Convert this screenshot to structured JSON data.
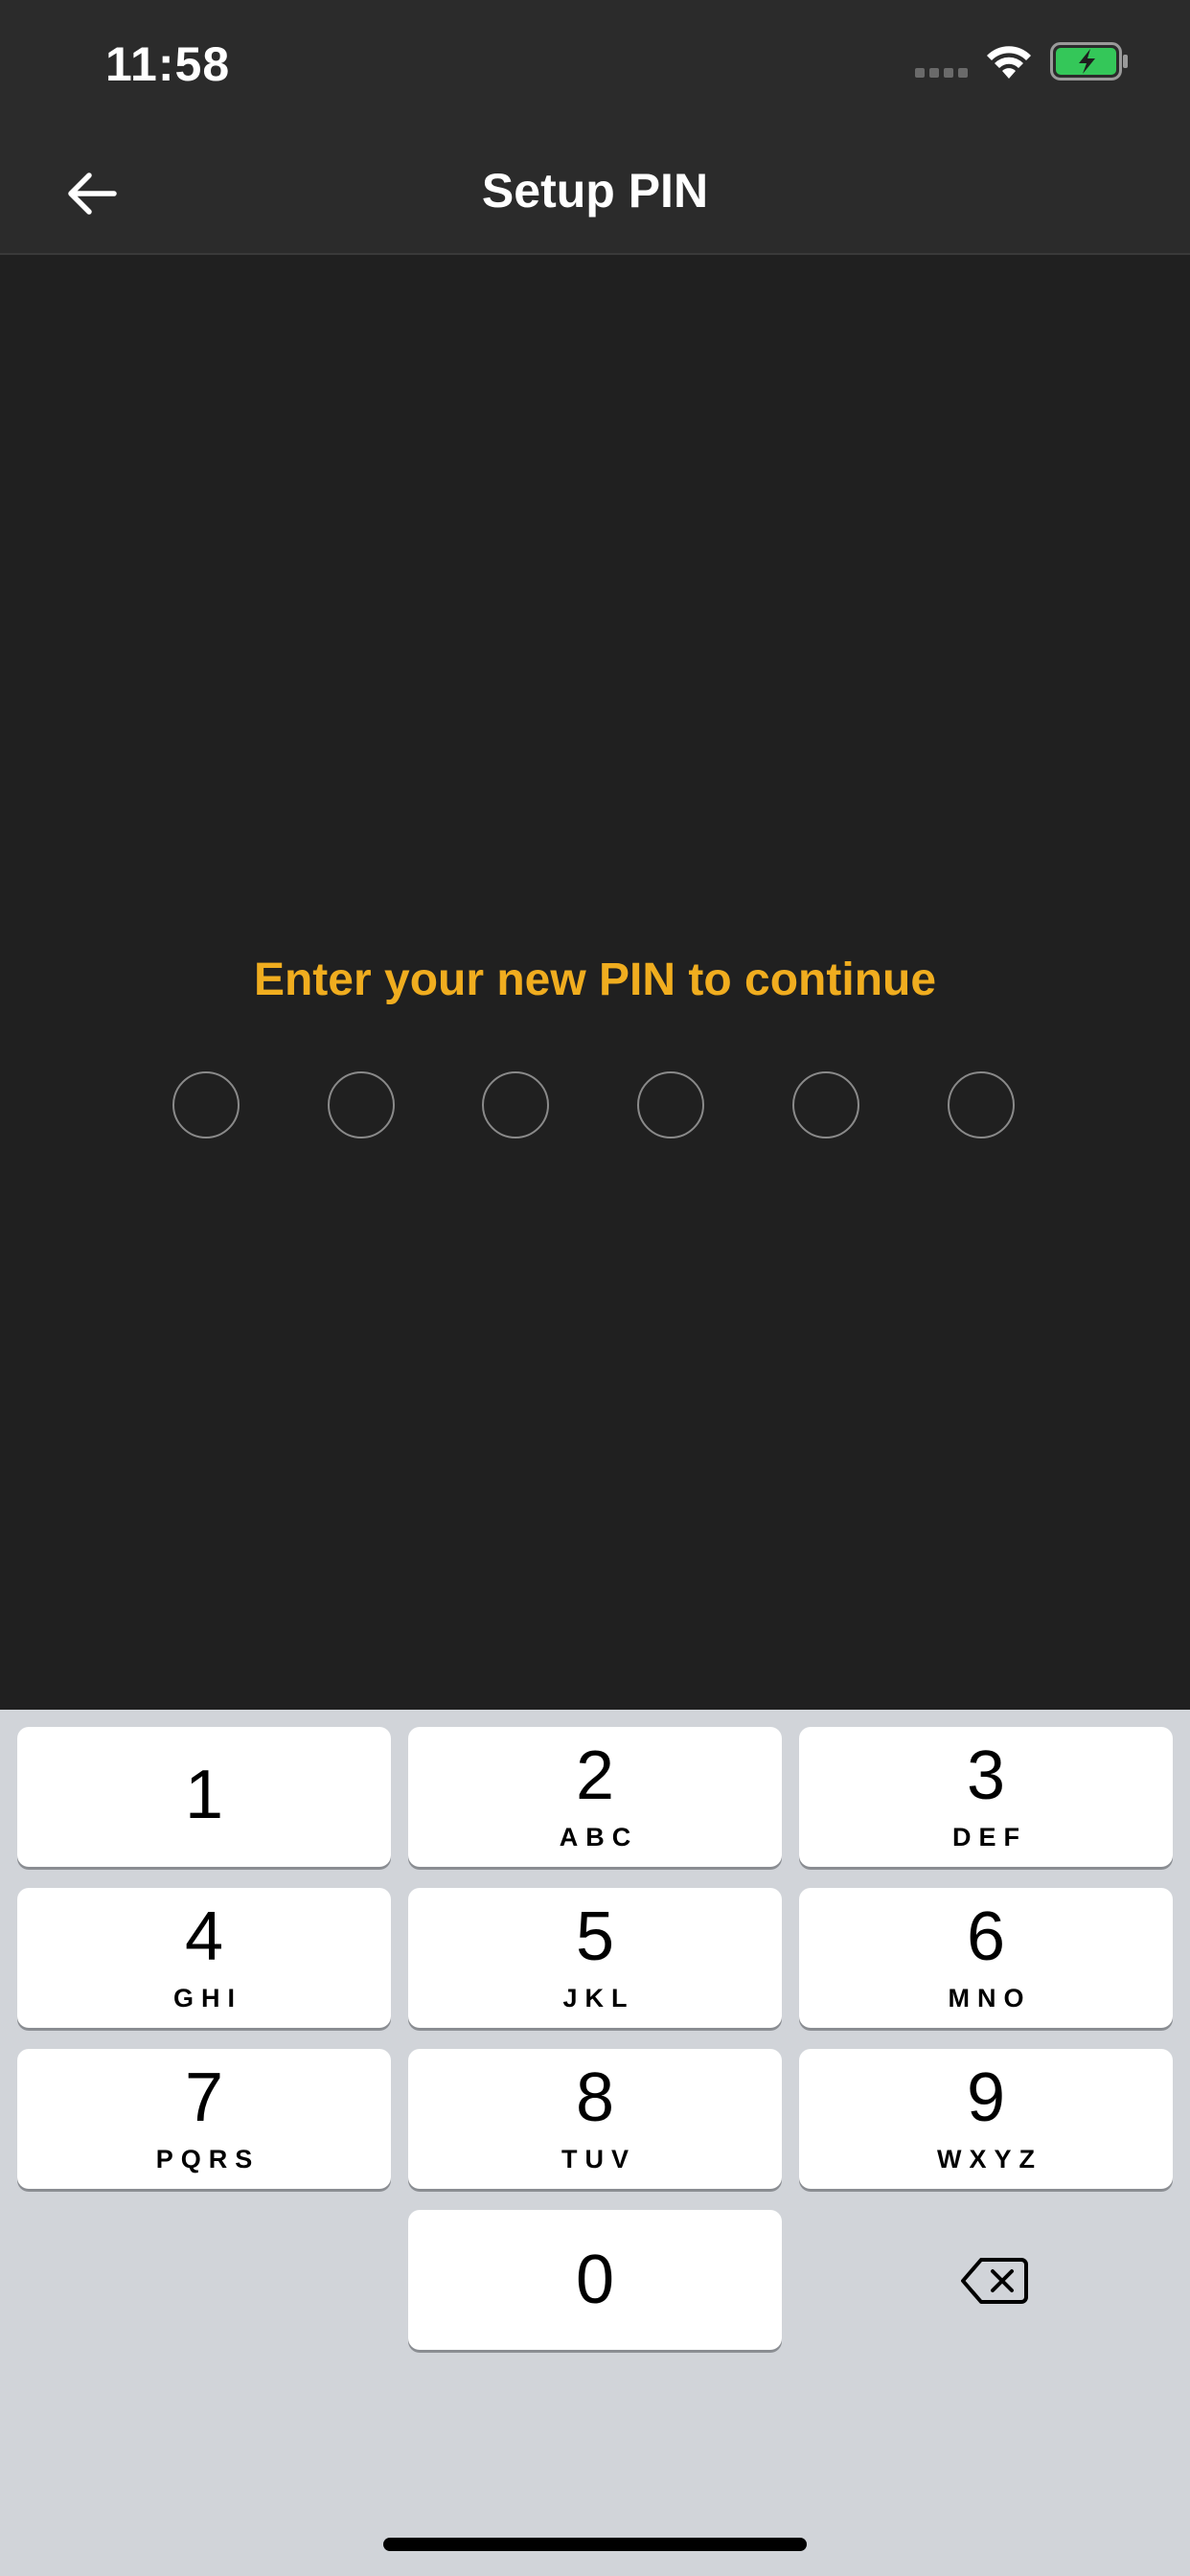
{
  "status_bar": {
    "time": "11:58",
    "battery_color": "#34c759"
  },
  "header": {
    "title": "Setup PIN",
    "back_icon": "arrow-left-icon"
  },
  "pin_entry": {
    "prompt": "Enter your new PIN to continue",
    "prompt_color": "#f0ad1f",
    "digits_total": 6,
    "digits_entered": 0
  },
  "keypad": {
    "keys": [
      {
        "digit": "1",
        "letters": ""
      },
      {
        "digit": "2",
        "letters": "ABC"
      },
      {
        "digit": "3",
        "letters": "DEF"
      },
      {
        "digit": "4",
        "letters": "GHI"
      },
      {
        "digit": "5",
        "letters": "JKL"
      },
      {
        "digit": "6",
        "letters": "MNO"
      },
      {
        "digit": "7",
        "letters": "PQRS"
      },
      {
        "digit": "8",
        "letters": "TUV"
      },
      {
        "digit": "9",
        "letters": "WXYZ"
      },
      {
        "digit": "0",
        "letters": ""
      }
    ],
    "delete_icon": "backspace-icon"
  }
}
